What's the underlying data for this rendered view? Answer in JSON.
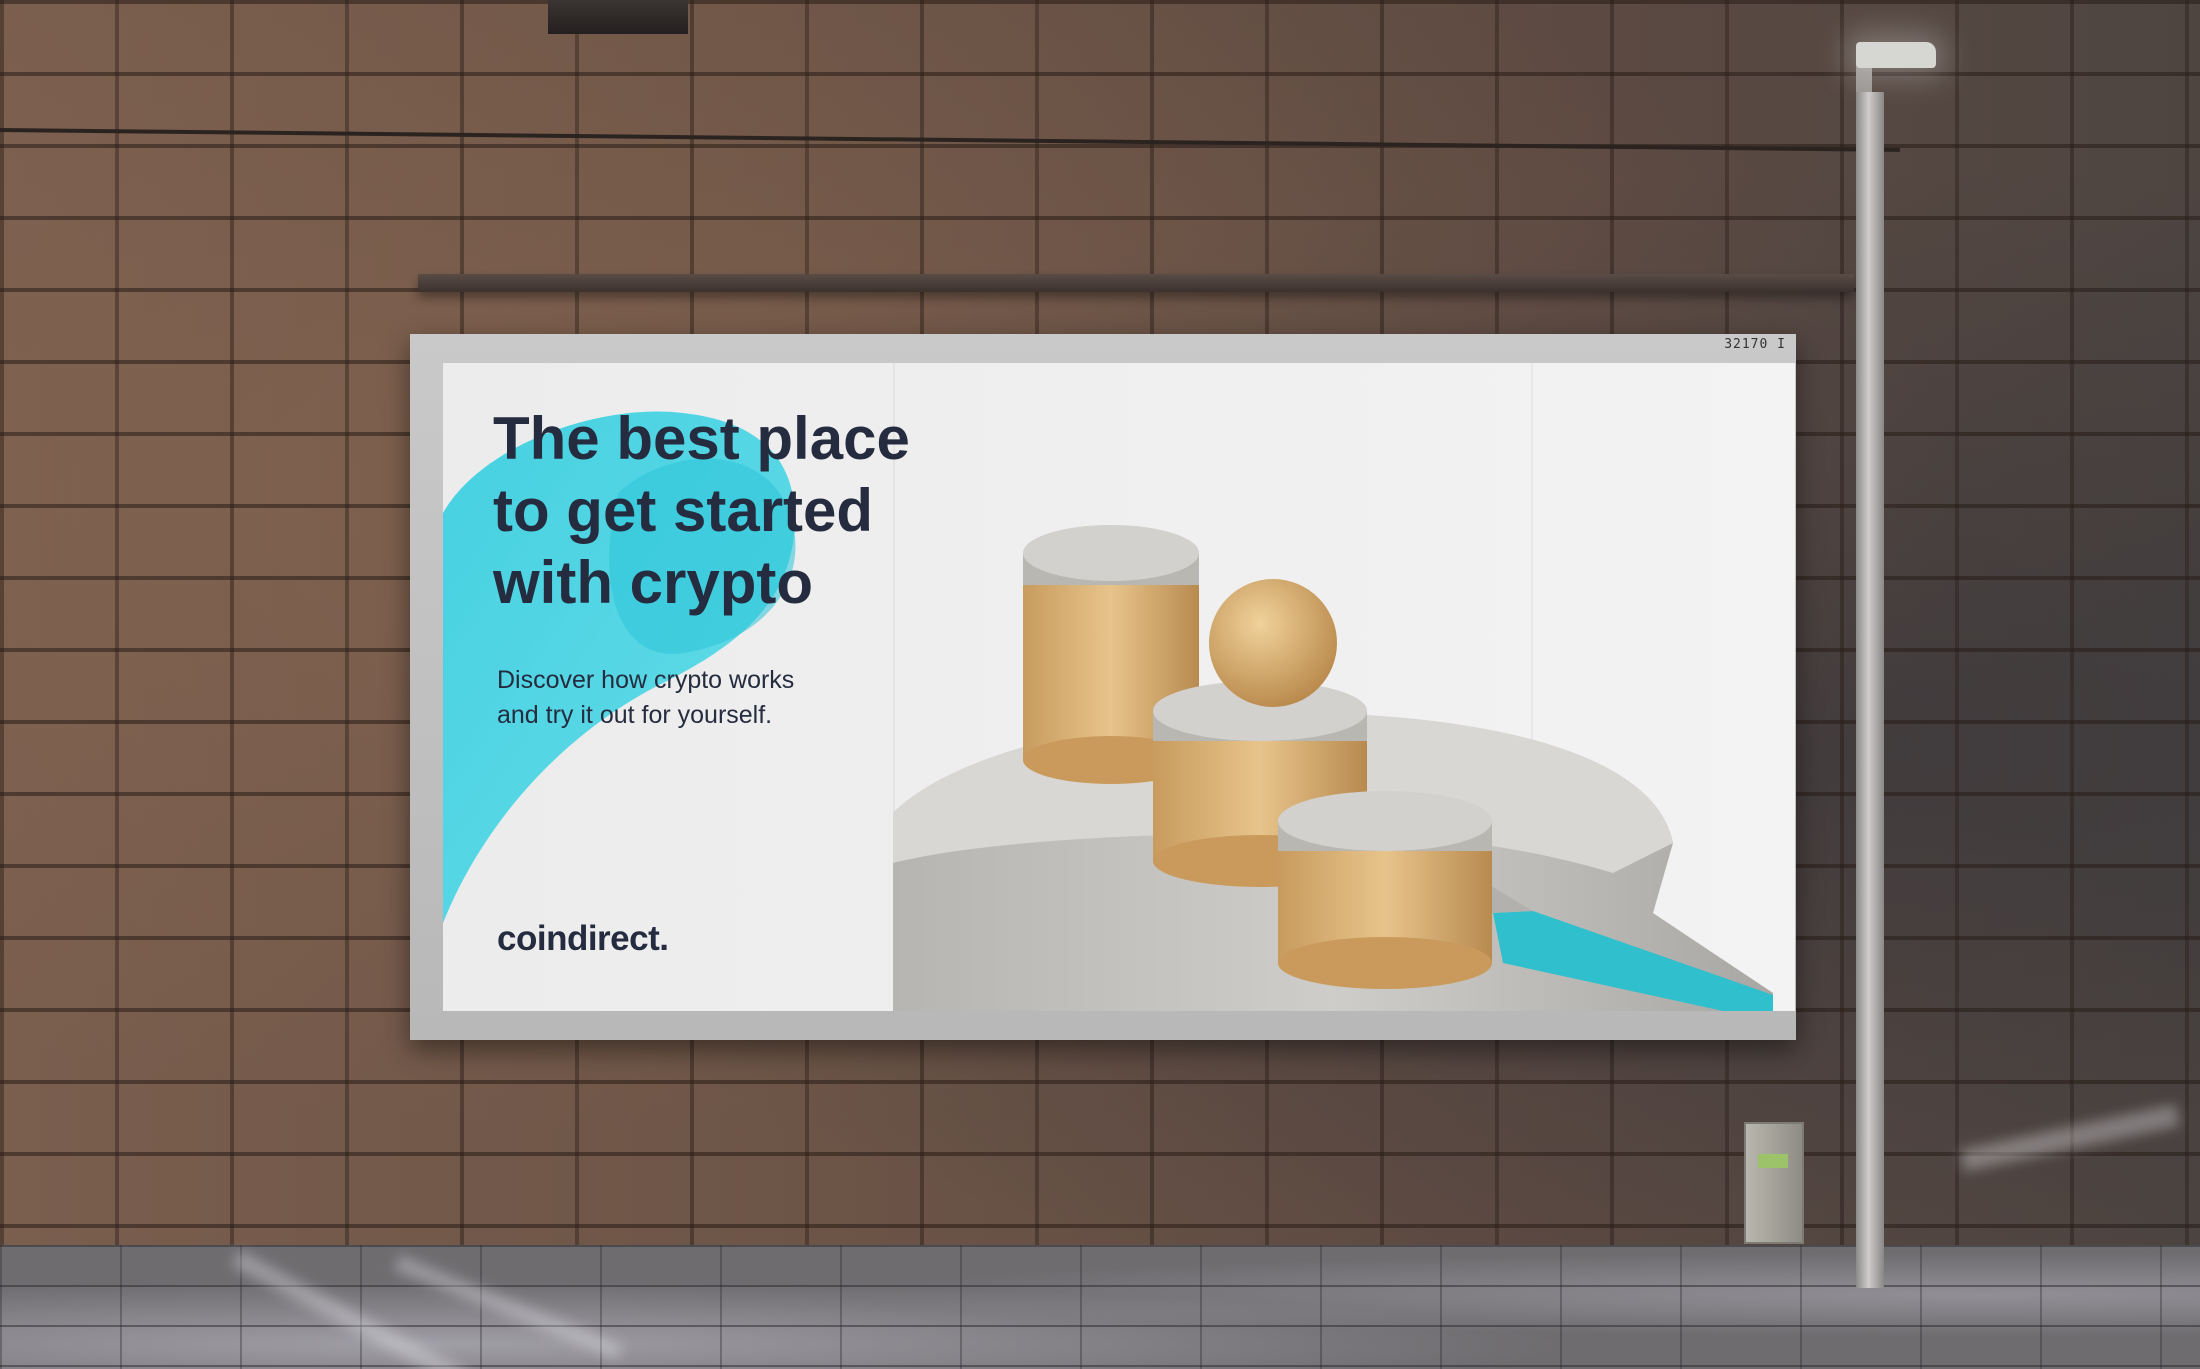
{
  "poster": {
    "headline_lines": [
      "The best place",
      "to get started",
      "with crypto"
    ],
    "subtext_lines": [
      "Discover how  crypto works",
      "and  try it out for yourself."
    ],
    "brand": "coindirect."
  },
  "frame": {
    "code": "32170 I"
  },
  "colors": {
    "accent": "#3fd0e0",
    "text": "#252c3f",
    "poster_bg": "#ededed"
  }
}
